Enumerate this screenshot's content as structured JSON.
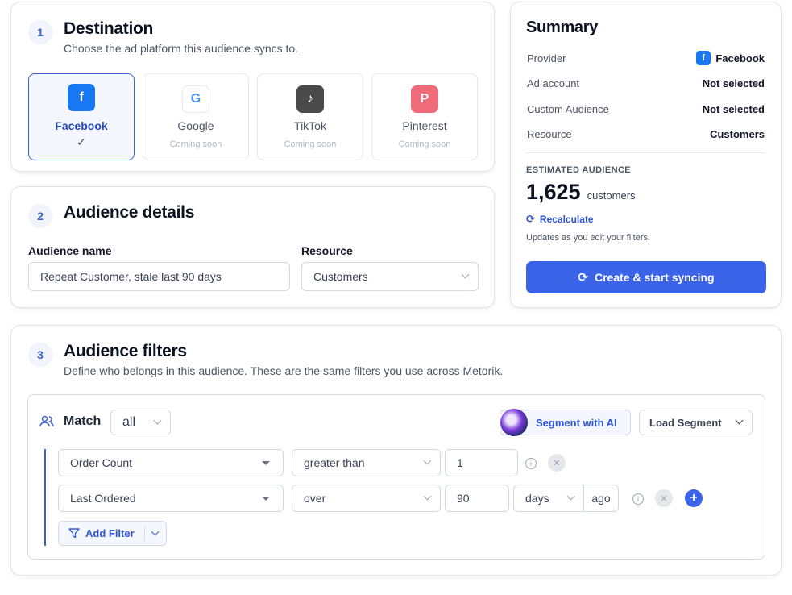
{
  "destination": {
    "step": "1",
    "title": "Destination",
    "subtitle": "Choose the ad platform this audience syncs to.",
    "platforms": [
      {
        "name": "Facebook",
        "status": "",
        "glyph": "f",
        "color": "#1877f2",
        "selected": true
      },
      {
        "name": "Google",
        "status": "Coming soon",
        "glyph": "G",
        "color": "#4b8df8",
        "selected": false
      },
      {
        "name": "TikTok",
        "status": "Coming soon",
        "glyph": "♪",
        "color": "#4a4a4a",
        "selected": false
      },
      {
        "name": "Pinterest",
        "status": "Coming soon",
        "glyph": "P",
        "color": "#f06b7a",
        "selected": false
      }
    ],
    "check_glyph": "✓"
  },
  "details": {
    "step": "2",
    "title": "Audience details",
    "name_label": "Audience name",
    "name_value": "Repeat Customer, stale last 90 days",
    "resource_label": "Resource",
    "resource_value": "Customers"
  },
  "summary": {
    "title": "Summary",
    "rows": [
      {
        "key": "Provider",
        "value": "Facebook"
      },
      {
        "key": "Ad account",
        "value": "Not selected"
      },
      {
        "key": "Custom Audience",
        "value": "Not selected"
      },
      {
        "key": "Resource",
        "value": "Customers"
      }
    ],
    "estimated_label": "ESTIMATED AUDIENCE",
    "count": "1,625",
    "count_unit": "customers",
    "recalculate": "Recalculate",
    "note": "Updates as you edit your filters.",
    "cta": "Create & start syncing"
  },
  "filters": {
    "step": "3",
    "title": "Audience filters",
    "subtitle": "Define who belongs in this audience. These are the same filters you use across Metorik.",
    "match_label": "Match",
    "match_value": "all",
    "segment_ai": "Segment with AI",
    "load_segment": "Load Segment",
    "rows": [
      {
        "field": "Order Count",
        "operator": "greater than",
        "value": "1"
      },
      {
        "field": "Last Ordered",
        "operator": "over",
        "value": "90",
        "unit": "days",
        "suffix": "ago"
      }
    ],
    "add_filter": "Add Filter"
  },
  "colors": {
    "accent": "#3b63e8",
    "facebook": "#1877f2"
  }
}
